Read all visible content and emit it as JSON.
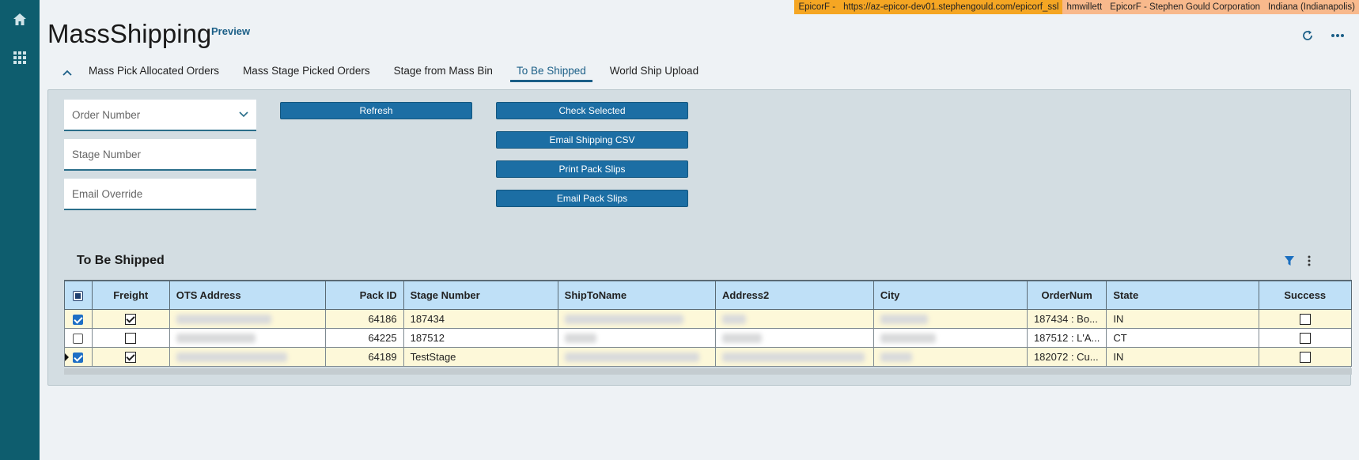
{
  "env": {
    "segments": [
      "EpicorF -",
      "https://az-epicor-dev01.stephengould.com/epicorf_ssl",
      "hmwillett",
      "EpicorF - Stephen Gould Corporation",
      "Indiana (Indianapolis)"
    ]
  },
  "app": {
    "title": "MassShipping",
    "badge": "Preview"
  },
  "tabs": [
    "Mass Pick Allocated Orders",
    "Mass Stage Picked Orders",
    "Stage from Mass Bin",
    "To Be Shipped",
    "World Ship Upload"
  ],
  "active_tab": "To Be Shipped",
  "fields": {
    "order_number": "Order Number",
    "stage_number": "Stage Number",
    "email_override": "Email Override"
  },
  "buttons": {
    "refresh": "Refresh",
    "check_selected": "Check Selected",
    "email_shipping_csv": "Email Shipping CSV",
    "print_pack_slips": "Print Pack Slips",
    "email_pack_slips": "Email Pack Slips"
  },
  "grid": {
    "title": "To Be Shipped",
    "columns": [
      "Freight",
      "OTS Address",
      "Pack ID",
      "Stage Number",
      "ShipToName",
      "Address2",
      "City",
      "OrderNum",
      "State",
      "Success"
    ],
    "rows": [
      {
        "selected": true,
        "freight": true,
        "pack_id": "64186",
        "stage_number": "187434",
        "order_num": "187434 : Bo...",
        "state": "IN",
        "success": false
      },
      {
        "selected": false,
        "freight": false,
        "pack_id": "64225",
        "stage_number": "187512",
        "order_num": "187512 : L'A...",
        "state": "CT",
        "success": false
      },
      {
        "selected": true,
        "freight": true,
        "pack_id": "64189",
        "stage_number": "TestStage",
        "order_num": "182072 : Cu...",
        "state": "IN",
        "success": false
      }
    ]
  },
  "colors": {
    "rail": "#0e5d6e",
    "accent": "#1b5f87",
    "button": "#1c6ea4",
    "header": "#bfe0f7",
    "row_highlight": "#fdf8d9"
  },
  "icons": [
    "home-icon",
    "apps-grid-icon",
    "refresh-icon",
    "more-icon",
    "chevron-up-icon",
    "chevron-down-icon",
    "filter-icon",
    "kebab-icon"
  ]
}
